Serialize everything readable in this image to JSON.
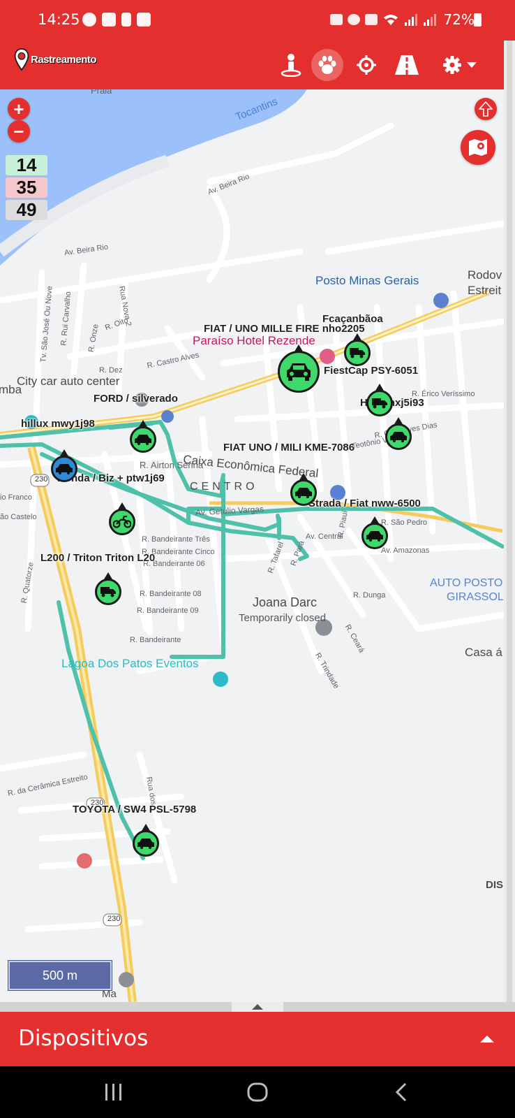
{
  "status_bar": {
    "time": "14:25",
    "battery": "72%",
    "left_icons": [
      "whatsapp-icon",
      "shield-icon",
      "lock-icon",
      "image-icon"
    ],
    "right_icons": [
      "key-icon",
      "alarm-icon",
      "mute-icon",
      "wifi-icon",
      "signal-icon",
      "signal-icon",
      "battery-icon"
    ]
  },
  "app_bar": {
    "logo_text": "Rastreamento",
    "tools": [
      "person-icon",
      "paw-icon",
      "crosshair-icon",
      "road-icon",
      "settings-icon"
    ]
  },
  "map": {
    "zoom_in": "+",
    "zoom_out": "−",
    "counts": {
      "online": "14",
      "offline": "35",
      "total": "49"
    },
    "scale": "500 m",
    "place_labels": {
      "tocantins": "Tocantins",
      "praia": "Praia",
      "beira_rio_1": "Av. Beira Rio",
      "beira_rio_2": "Av. Beira Rio",
      "posto_minas": "Posto Minas Gerais",
      "rodov": "Rodov",
      "estreit": "Estreit",
      "paraiso_hotel": "Paraíso Hotel Rezende",
      "city_car": "City car auto center",
      "mba": "mba",
      "caixa": "Caixa Econômica Federal",
      "centro": "CENTRO",
      "av_airton": "R. Airton Senna",
      "av_getulio": "Av. Getúlio Vargas",
      "r_castro": "R. Castro Alves",
      "r_dez": "R. Dez",
      "r_onze": "R. Onze",
      "r_oito": "R. Oito",
      "r_rui": "R. Rui Carvalho",
      "tv_sao_jose": "Tv. São José Ou Nove",
      "rua_nova_2": "Rua Nova 2",
      "r_teotonio": "R. Teotônio Vilela",
      "r_dias": "R. Gonçalves Dias",
      "r_verissimo": "R. Érico Veríssimo",
      "av_central": "Av. Central",
      "av_amazonas": "Av. Amazonas",
      "r_sao_pedro": "R. São Pedro",
      "joana_darc": "Joana Darc",
      "temp_closed": "Temporarily closed",
      "auto_posto": "AUTO POSTO",
      "girassol": "GIRASSOL",
      "casa": "Casa á",
      "lagoa": "Lagoa Dos Patos Eventos",
      "r_bandeirante_tres": "R. Bandeirante Três",
      "r_bandeirante_cinco": "R. Bandeirante Cinco",
      "r_bandeirante_06": "R. Bandeirante 06",
      "r_bandeirante_08": "R. Bandeirante 08",
      "r_bandeirante_09": "R. Bandeirante 09",
      "r_bandeirante": "R. Bandeirante",
      "r_quatorze": "R. Quatorze",
      "io_franco": "io Franco",
      "ao_castelo": "ão Castelo",
      "r_ceramica": "R. da Cerâmica Estreito",
      "rua_dos": "Rua dos",
      "r_dunga": "R. Dunga",
      "r_ceara": "R. Ceará",
      "r_trindade": "R. Trindade",
      "r_tafarel": "R. Tafarel",
      "r_para": "R. Pará",
      "r_piaui": "R. Piauí",
      "dis": "DIS",
      "ma": "Ma",
      "hw_230_a": "230",
      "hw_230_b": "230",
      "hw_230_c": "230"
    },
    "vehicles": [
      {
        "label": "Fcaçanbãoa",
        "icon": "truck-icon"
      },
      {
        "label": "FIAT / UNO MILLE FIRE nho2205",
        "icon": "car-icon"
      },
      {
        "label": "FiestCap PSY-6051",
        "icon": "car-icon"
      },
      {
        "label": "Hilux nxj5i93",
        "icon": "truck-icon"
      },
      {
        "label": "",
        "icon": "car-icon"
      },
      {
        "label": "FORD / silverado",
        "icon": "car-icon"
      },
      {
        "label": "hillux mwy1j98",
        "icon": "car-icon"
      },
      {
        "label": "",
        "icon": "car-icon"
      },
      {
        "label": "FIAT UNO / MILI KME-7086",
        "icon": "car-icon"
      },
      {
        "label": "Honda / Biz + ptw1j69",
        "icon": "motorcycle-icon"
      },
      {
        "label": "Strada / Fiat nww-6500",
        "icon": "car-icon"
      },
      {
        "label": "L200 / Triton Triton L20",
        "icon": "truck-icon"
      },
      {
        "label": "TOYOTA / SW4 PSL-5798",
        "icon": "car-icon"
      }
    ]
  },
  "bottom_panel": {
    "title": "Dispositivos"
  },
  "nav_bar": {
    "buttons": [
      "recents-icon",
      "home-icon",
      "back-icon"
    ]
  },
  "colors": {
    "brand": "#e3302f",
    "route": "#4fc0aa",
    "marker": "#3ed96a",
    "water": "#9cc0f9",
    "highway": "#f5cb5c"
  }
}
